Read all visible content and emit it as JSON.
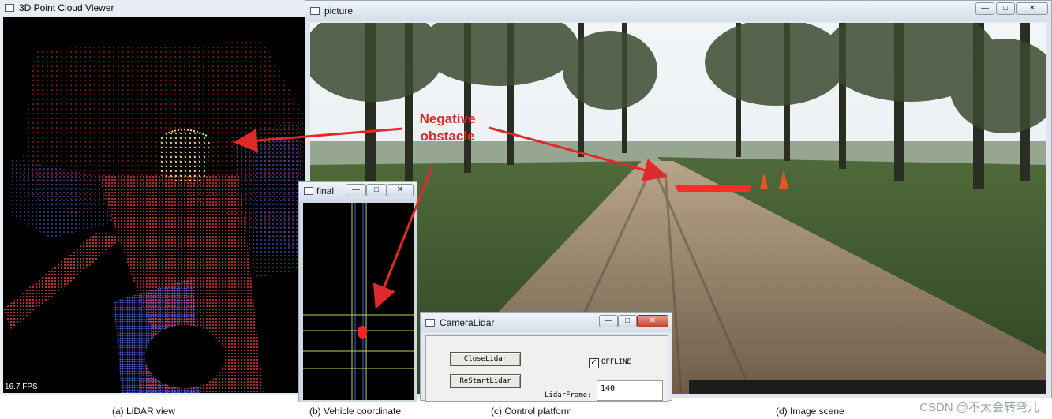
{
  "lidar_window": {
    "title": "3D Point Cloud Viewer",
    "fps": "16.7 FPS"
  },
  "picture_window": {
    "title": "picture"
  },
  "final_window": {
    "title": "final"
  },
  "camera_window": {
    "title": "CameraLidar",
    "close_lidar_label": "CloseLidar",
    "restart_lidar_label": "ReStartLidar",
    "offline_label": "OFFLINE",
    "offline_checked": true,
    "lidar_frame_label": "LidarFrame:",
    "lidar_frame_value": "140"
  },
  "annotation": {
    "line1": "Negative",
    "line2": "obstacle",
    "color": "#e02a2a"
  },
  "captions": {
    "a": "(a) LiDAR view",
    "b": "(b) Vehicle coordinate",
    "c": "(c) Control platform",
    "d": "(d) Image scene"
  },
  "watermark": "CSDN @不太会转弯儿",
  "window_controls": {
    "minimize": "—",
    "maximize": "□",
    "close": "✕"
  }
}
